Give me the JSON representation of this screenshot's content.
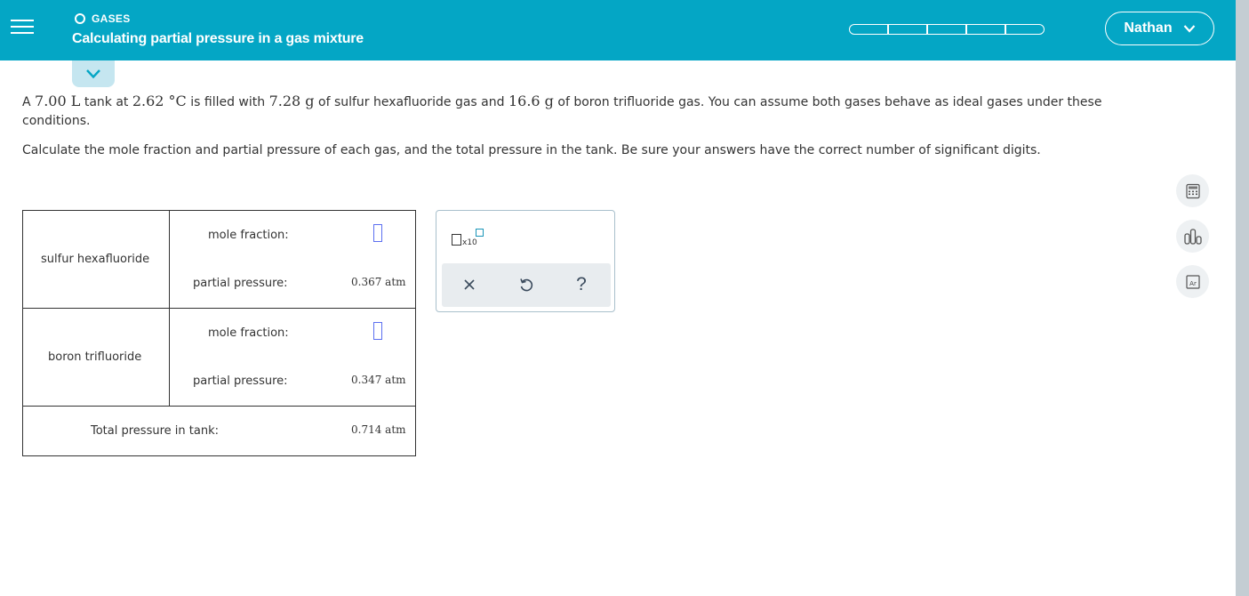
{
  "header": {
    "topic": "GASES",
    "title": "Calculating partial pressure in a gas mixture",
    "progress_segments": 5,
    "user_name": "Nathan"
  },
  "question": {
    "p1_a": "A ",
    "p1_vol": "7.00 L",
    "p1_b": " tank at ",
    "p1_temp": "2.62 °C",
    "p1_c": " is filled with ",
    "p1_m1": "7.28 g",
    "p1_d": " of sulfur hexafluoride gas and ",
    "p1_m2": "16.6 g",
    "p1_e": " of boron trifluoride gas. You can assume both gases behave as ideal gases under these conditions.",
    "p2": "Calculate the mole fraction and partial pressure of each gas, and the total pressure in the tank. Be sure your answers have the correct number of significant digits."
  },
  "table": {
    "gas1": {
      "name": "sulfur hexafluoride",
      "mole_fraction_label": "mole fraction:",
      "mole_fraction_value": "",
      "partial_pressure_label": "partial pressure:",
      "partial_pressure_value": "0.367 atm"
    },
    "gas2": {
      "name": "boron trifluoride",
      "mole_fraction_label": "mole fraction:",
      "mole_fraction_value": "",
      "partial_pressure_label": "partial pressure:",
      "partial_pressure_value": "0.347 atm"
    },
    "total_label": "Total pressure in tank:",
    "total_value": "0.714 atm"
  },
  "keypad": {
    "sci_notation_label": "x10",
    "clear_symbol": "×",
    "help_symbol": "?"
  },
  "tools": [
    "calculator-icon",
    "data-chart-icon",
    "periodic-table-icon"
  ],
  "tools_periodic_label": "Ar",
  "colors": {
    "header_bg": "#04a6c5",
    "answer_box_border": "#5c6ff0",
    "gutter": "#c4cdd3"
  }
}
